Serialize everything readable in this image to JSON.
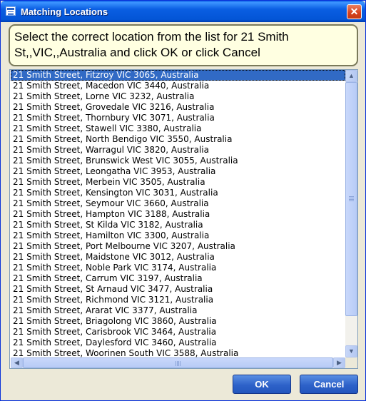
{
  "window": {
    "title": "Matching Locations",
    "close_glyph": "✕"
  },
  "prompt": {
    "text": "Select the correct location from the list for 21 Smith St,,VIC,,Australia and click OK or click Cancel"
  },
  "list": {
    "selected_index": 0,
    "items": [
      "21 Smith Street, Fitzroy VIC 3065, Australia",
      "21 Smith Street, Macedon VIC 3440, Australia",
      "21 Smith Street, Lorne VIC 3232, Australia",
      "21 Smith Street, Grovedale VIC 3216, Australia",
      "21 Smith Street, Thornbury VIC 3071, Australia",
      "21 Smith Street, Stawell VIC 3380, Australia",
      "21 Smith Street, North Bendigo VIC 3550, Australia",
      "21 Smith Street, Warragul VIC 3820, Australia",
      "21 Smith Street, Brunswick West VIC 3055, Australia",
      "21 Smith Street, Leongatha VIC 3953, Australia",
      "21 Smith Street, Merbein VIC 3505, Australia",
      "21 Smith Street, Kensington VIC 3031, Australia",
      "21 Smith Street, Seymour VIC 3660, Australia",
      "21 Smith Street, Hampton VIC 3188, Australia",
      "21 Smith Street, St Kilda VIC 3182, Australia",
      "21 Smith Street, Hamilton VIC 3300, Australia",
      "21 Smith Street, Port Melbourne VIC 3207, Australia",
      "21 Smith Street, Maidstone VIC 3012, Australia",
      "21 Smith Street, Noble Park VIC 3174, Australia",
      "21 Smith Street, Carrum VIC 3197, Australia",
      "21 Smith Street, St Arnaud VIC 3477, Australia",
      "21 Smith Street, Richmond VIC 3121, Australia",
      "21 Smith Street, Ararat VIC 3377, Australia",
      "21 Smith Street, Briagolong VIC 3860, Australia",
      "21 Smith Street, Carisbrook VIC 3464, Australia",
      "21 Smith Street, Daylesford VIC 3460, Australia",
      "21 Smith Street, Woorinen South VIC 3588, Australia"
    ]
  },
  "buttons": {
    "ok_label": "OK",
    "cancel_label": "Cancel"
  },
  "icons": {
    "app": "form-window-icon",
    "close": "close-icon",
    "scroll_up": "arrow-up-icon",
    "scroll_down": "arrow-down-icon",
    "scroll_left": "arrow-left-icon",
    "scroll_right": "arrow-right-icon"
  },
  "colors": {
    "titlebar": "#0355d6",
    "selection": "#316ac5",
    "prompt_background": "#ffffe1",
    "dialog_background": "#ece9d8",
    "button": "#2e62c9"
  }
}
